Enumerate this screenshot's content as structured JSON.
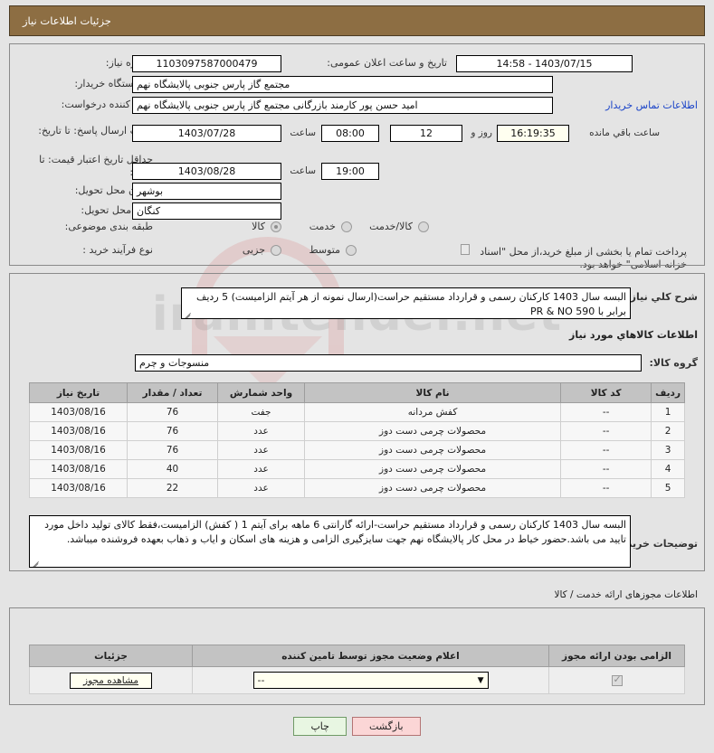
{
  "header": {
    "title": "جزئیات اطلاعات نیاز"
  },
  "form": {
    "need_number_label": "شماره نیاز:",
    "need_number_value": "1103097587000479",
    "public_announce_label": "تاریخ و ساعت اعلان عمومی:",
    "public_announce_value": "1403/07/15 - 14:58",
    "buyer_org_label": "نام دستگاه خریدار:",
    "buyer_org_value": "مجتمع گاز پارس جنوبی  پالایشگاه نهم",
    "creator_label": "ایجاد کننده درخواست:",
    "creator_value": "امید حسن پور کارمند بازرگانی مجتمع گاز پارس جنوبی  پالایشگاه نهم",
    "contact_link": "اطلاعات تماس خریدار",
    "response_deadline_label": "مهلت ارسال پاسخ: تا تاریخ:",
    "response_deadline_date": "1403/07/28",
    "hour_label": "ساعت",
    "response_deadline_time": "08:00",
    "remaining_days": "12",
    "remaining_days_unit": "روز و",
    "remaining_timer": "16:19:35",
    "remaining_suffix": "ساعت باقي مانده",
    "price_validity_label": "حداقل تاریخ اعتبار قیمت: تا تاریخ:",
    "price_validity_date": "1403/08/28",
    "price_validity_time": "19:00",
    "province_label": "استان محل تحویل:",
    "province_value": "بوشهر",
    "city_label": "شهر محل تحویل:",
    "city_value": "کنگان",
    "category_label": "طبقه بندی موضوعی:",
    "category_options": [
      "کالا",
      "خدمت",
      "کالا/خدمت"
    ],
    "category_selected": 0,
    "process_label": "نوع فرآیند خرید :",
    "process_options": [
      "جزیی",
      "متوسط"
    ],
    "process_selected": -1,
    "treasury_checkbox_label": "پرداخت تمام یا بخشی از مبلغ خرید،از محل \"اسناد خزانه اسلامی\" خواهد بود.",
    "treasury_checked": false
  },
  "need_summary": {
    "label": "شرح کلي نياز:",
    "value": "البسه سال 1403 کارکنان رسمی و قرارداد مستقیم حراست(ارسال نمونه از هر آیتم الزامیست) 5 ردیف برابر با  590   PR & NO"
  },
  "goods": {
    "section_title": "اطلاعات کالاهاي مورد نياز",
    "group_label": "گروه کالا:",
    "group_value": "منسوجات و چرم",
    "columns": [
      "ردیف",
      "کد کالا",
      "نام کالا",
      "واحد شمارش",
      "تعداد / مقدار",
      "تاریخ نیاز"
    ],
    "rows": [
      {
        "row": "1",
        "code": "--",
        "name": "کفش مردانه",
        "unit": "جفت",
        "qty": "76",
        "date": "1403/08/16"
      },
      {
        "row": "2",
        "code": "--",
        "name": "محصولات چرمی دست دوز",
        "unit": "عدد",
        "qty": "76",
        "date": "1403/08/16"
      },
      {
        "row": "3",
        "code": "--",
        "name": "محصولات چرمی دست دوز",
        "unit": "عدد",
        "qty": "76",
        "date": "1403/08/16"
      },
      {
        "row": "4",
        "code": "--",
        "name": "محصولات چرمی دست دوز",
        "unit": "عدد",
        "qty": "40",
        "date": "1403/08/16"
      },
      {
        "row": "5",
        "code": "--",
        "name": "محصولات چرمی دست دوز",
        "unit": "عدد",
        "qty": "22",
        "date": "1403/08/16"
      }
    ]
  },
  "buyer_notes": {
    "label": "توضیحات خریدار:",
    "value": "البسه سال 1403 کارکنان رسمی و قرارداد مستقیم حراست-ارائه گارانتی 6 ماهه برای آیتم 1 ( کفش)  الزامیست،فقط کالای تولید داخل مورد تایید می باشد.حضور خیاط در محل کار پالایشگاه نهم جهت سایزگیری الزامی و هزینه های اسکان و ایاب و ذهاب بعهده فروشنده میباشد."
  },
  "permit": {
    "section_title": "اطلاعات مجوزهای ارائه خدمت / کالا",
    "columns": [
      "الزامی بودن ارائه مجوز",
      "اعلام وضعیت مجوز توسط تامین کننده",
      "جزئیات"
    ],
    "required_checked": true,
    "status_value": "--",
    "details_button": "مشاهده مجوز"
  },
  "footer": {
    "print_label": "چاپ",
    "back_label": "بازگشت"
  },
  "watermark": {
    "text": "iranitender.net"
  },
  "colors": {
    "header_brown": "#8d6e43",
    "link_blue": "#1b44c8",
    "table_header_gray": "#c3c3c3",
    "print_green": "#e8f6e2",
    "back_pink": "#fbd6d6",
    "cream": "#fffff0"
  }
}
